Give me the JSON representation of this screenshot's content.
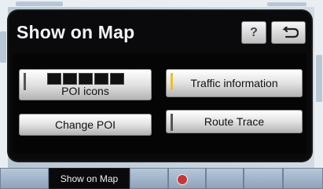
{
  "dialog": {
    "title": "Show on Map",
    "help_label": "?",
    "back_icon": "return-arrow-icon"
  },
  "buttons": {
    "poi_icons": "POI icons",
    "change_poi": "Change POI",
    "traffic_information": "Traffic information",
    "route_trace": "Route Trace"
  },
  "indicators": {
    "traffic_information_on": true,
    "route_trace_on": false,
    "poi_icons_on": false
  },
  "colors": {
    "dialog_bg": "#0a0a0c",
    "indicator_on": "#e8c12a",
    "tab_active_bg": "#0a0a0c"
  },
  "tabs": {
    "active_label": "Show on Map"
  }
}
